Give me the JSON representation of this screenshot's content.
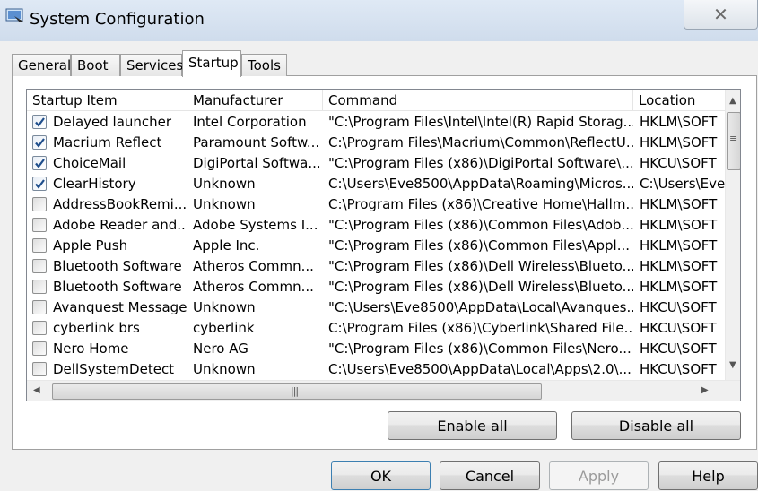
{
  "window": {
    "title": "System Configuration",
    "title_icon": "msconfig-icon",
    "close_glyph": "✕"
  },
  "tabs": [
    {
      "label": "General",
      "active": false
    },
    {
      "label": "Boot",
      "active": false
    },
    {
      "label": "Services",
      "active": false
    },
    {
      "label": "Startup",
      "active": true
    },
    {
      "label": "Tools",
      "active": false
    }
  ],
  "startup": {
    "columns": [
      "Startup Item",
      "Manufacturer",
      "Command",
      "Location"
    ],
    "rows": [
      {
        "checked": true,
        "item": "Delayed launcher",
        "manufacturer": "Intel Corporation",
        "command": "\"C:\\Program Files\\Intel\\Intel(R) Rapid Storag...",
        "location": "HKLM\\SOFT"
      },
      {
        "checked": true,
        "item": "Macrium Reflect",
        "manufacturer": "Paramount Softw...",
        "command": "C:\\Program Files\\Macrium\\Common\\ReflectU...",
        "location": "HKLM\\SOFT"
      },
      {
        "checked": true,
        "item": "ChoiceMail",
        "manufacturer": "DigiPortal Softwa...",
        "command": "\"C:\\Program Files (x86)\\DigiPortal Software\\...",
        "location": "HKCU\\SOFT"
      },
      {
        "checked": true,
        "item": "ClearHistory",
        "manufacturer": "Unknown",
        "command": "C:\\Users\\Eve8500\\AppData\\Roaming\\Micros...",
        "location": "C:\\Users\\Eve"
      },
      {
        "checked": false,
        "item": "AddressBookRemi...",
        "manufacturer": "Unknown",
        "command": "C:\\Program Files (x86)\\Creative Home\\Hallm...",
        "location": "HKLM\\SOFT"
      },
      {
        "checked": false,
        "item": "Adobe Reader and...",
        "manufacturer": "Adobe Systems I...",
        "command": "\"C:\\Program Files (x86)\\Common Files\\Adob...",
        "location": "HKLM\\SOFT"
      },
      {
        "checked": false,
        "item": "Apple Push",
        "manufacturer": "Apple Inc.",
        "command": "\"C:\\Program Files (x86)\\Common Files\\Appl...",
        "location": "HKLM\\SOFT"
      },
      {
        "checked": false,
        "item": "Bluetooth Software",
        "manufacturer": "Atheros Commn...",
        "command": "\"C:\\Program Files (x86)\\Dell Wireless\\Blueto...",
        "location": "HKLM\\SOFT"
      },
      {
        "checked": false,
        "item": "Bluetooth Software",
        "manufacturer": "Atheros Commn...",
        "command": "\"C:\\Program Files (x86)\\Dell Wireless\\Blueto...",
        "location": "HKLM\\SOFT"
      },
      {
        "checked": false,
        "item": "Avanquest Message",
        "manufacturer": "Unknown",
        "command": "\"C:\\Users\\Eve8500\\AppData\\Local\\Avanques...",
        "location": "HKCU\\SOFT"
      },
      {
        "checked": false,
        "item": "cyberlink brs",
        "manufacturer": "cyberlink",
        "command": "C:\\Program Files (x86)\\Cyberlink\\Shared File...",
        "location": "HKCU\\SOFT"
      },
      {
        "checked": false,
        "item": "Nero Home",
        "manufacturer": "Nero AG",
        "command": "\"C:\\Program Files (x86)\\Common Files\\Nero...",
        "location": "HKCU\\SOFT"
      },
      {
        "checked": false,
        "item": "DellSystemDetect",
        "manufacturer": "Unknown",
        "command": "C:\\Users\\Eve8500\\AppData\\Local\\Apps\\2.0\\...",
        "location": "HKCU\\SOFT"
      }
    ]
  },
  "actions": {
    "enable_all": "Enable all",
    "disable_all": "Disable all"
  },
  "footer": {
    "ok": "OK",
    "cancel": "Cancel",
    "apply": "Apply",
    "help": "Help"
  },
  "colors": {
    "titlebar": "#d5e1ef",
    "panel": "#ffffff",
    "check_blue": "#1f4e8c"
  }
}
